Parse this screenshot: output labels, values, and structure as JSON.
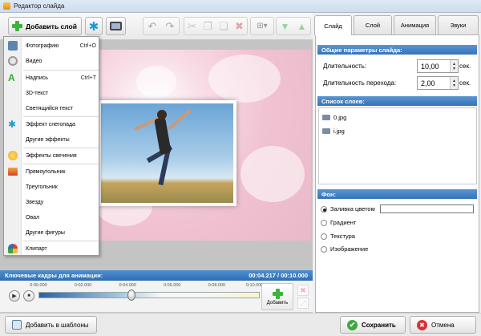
{
  "window": {
    "title": "Редактор слайда"
  },
  "toolbar": {
    "add_layer_label": "Добавить слой",
    "snow_glyph": "✱",
    "undo_glyph": "↶",
    "redo_glyph": "↷",
    "cut_glyph": "✂",
    "copy_glyph": "❐",
    "paste_glyph": "❏",
    "delete_glyph": "✖",
    "arrange_glyph": "⊞▾",
    "down_glyph": "▼",
    "up_glyph": "▲"
  },
  "menu": {
    "items": [
      {
        "label": "Фотографию",
        "shortcut": "Ctrl+O",
        "icon": "photo-icon"
      },
      {
        "label": "Видео",
        "shortcut": "",
        "icon": "video-icon"
      },
      {
        "label": "Надпись",
        "shortcut": "Ctrl+T",
        "icon": "text-icon"
      },
      {
        "label": "3D-текст",
        "shortcut": "",
        "icon": ""
      },
      {
        "label": "Светящийся текст",
        "shortcut": "",
        "icon": ""
      },
      {
        "label": "Эффект снегопада",
        "shortcut": "",
        "icon": "snowflake-icon"
      },
      {
        "label": "Другие эффекты",
        "shortcut": "",
        "icon": ""
      },
      {
        "label": "Эффекты свечения",
        "shortcut": "",
        "icon": "glow-icon"
      },
      {
        "label": "Прямоугольник",
        "shortcut": "",
        "icon": "rectangle-icon"
      },
      {
        "label": "Треугольник",
        "shortcut": "",
        "icon": ""
      },
      {
        "label": "Звезду",
        "shortcut": "",
        "icon": ""
      },
      {
        "label": "Овал",
        "shortcut": "",
        "icon": ""
      },
      {
        "label": "Другие фигуры",
        "shortcut": "",
        "icon": ""
      },
      {
        "label": "Клипарт",
        "shortcut": "",
        "icon": "clipart-icon"
      }
    ]
  },
  "keyframes": {
    "title": "Ключевые кадры для анимации:",
    "time": "00:04.217 / 00:10.000",
    "ticks": [
      "0:00.000",
      "0:02.000",
      "0:04.000",
      "0:06.000",
      "0:08.000",
      "0:10.000"
    ],
    "position_fraction": 0.42,
    "add_label": "Добавить"
  },
  "bottom": {
    "templates_label": "Добавить в шаблоны",
    "save_label": "Сохранить",
    "cancel_label": "Отмена"
  },
  "tabs": [
    "Слайд",
    "Слой",
    "Анимация",
    "Звуки"
  ],
  "slide_params": {
    "header": "Общие параметры слайда:",
    "duration_label": "Длительность:",
    "duration_value": "10,00",
    "transition_label": "Длительность перехода:",
    "transition_value": "2,00",
    "unit": "сек."
  },
  "layers": {
    "header": "Список слоев:",
    "items": [
      "0.jpg",
      "i.jpg"
    ]
  },
  "background": {
    "header": "Фон:",
    "options": [
      "Заливка цветом",
      "Градиент",
      "Текстура",
      "Изображение"
    ],
    "selected_index": 0
  },
  "colors": {
    "accent": "#3673b8",
    "save_green": "#3ba93b",
    "cancel_red": "#d93232"
  }
}
